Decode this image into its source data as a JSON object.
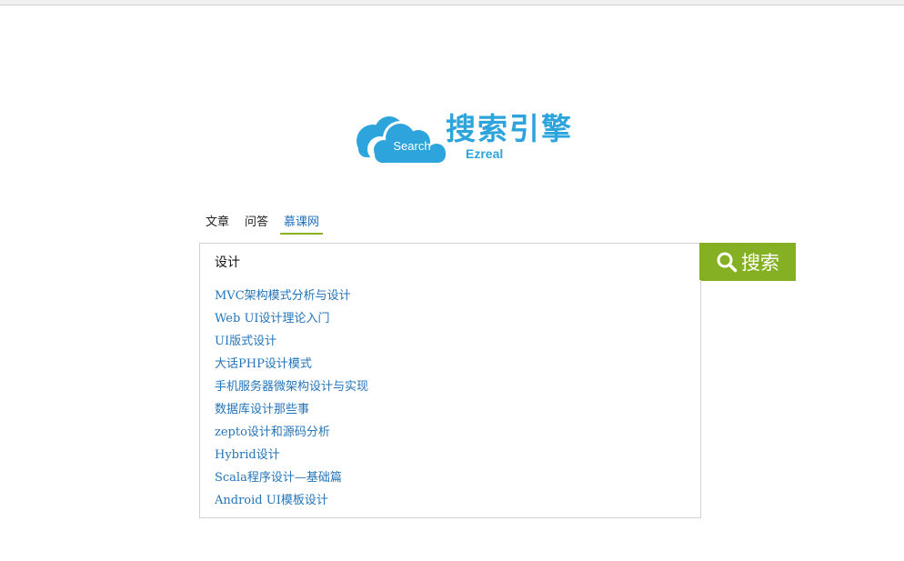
{
  "logo": {
    "cloud_text": "Search",
    "title": "搜索引擎",
    "subtitle": "Ezreal",
    "color": "#2ea4dc"
  },
  "tabs": [
    {
      "label": "文章",
      "active": false
    },
    {
      "label": "问答",
      "active": false
    },
    {
      "label": "慕课网",
      "active": true
    }
  ],
  "search": {
    "value": "设计",
    "button_label": "搜索",
    "button_icon": "search-icon",
    "button_color": "#86b023"
  },
  "suggestions": [
    "MVC架构模式分析与设计",
    "Web UI设计理论入门",
    "UI版式设计",
    "大话PHP设计模式",
    "手机服务器微架构设计与实现",
    "数据库设计那些事",
    "zepto设计和源码分析",
    "Hybrid设计",
    "Scala程序设计—基础篇",
    "Android UI模板设计"
  ]
}
